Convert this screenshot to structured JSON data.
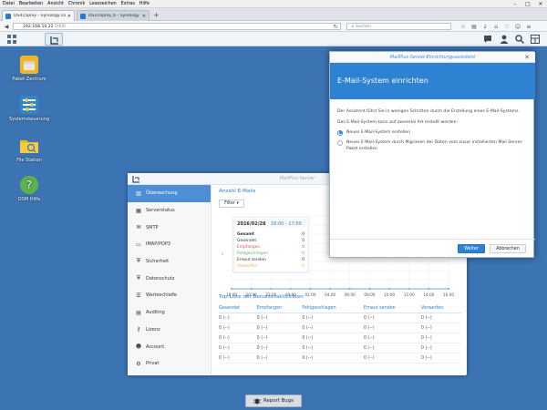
{
  "browser": {
    "menu": [
      "Datei",
      "Bearbeiten",
      "Ansicht",
      "Chronik",
      "Lesezeichen",
      "Extras",
      "Hilfe"
    ],
    "tabs": [
      {
        "label": "DS415play - Synology Disk..."
      },
      {
        "label": "DS216play_6 - Synology Dis..."
      }
    ],
    "new_tab": "+",
    "url_host": "192.168.10.22",
    "url_port": ":5000",
    "search_placeholder": "Suchen"
  },
  "desktop": {
    "icons": [
      {
        "label": "Paket-Zentrum"
      },
      {
        "label": "Systemsteuerung"
      },
      {
        "label": "File Station"
      },
      {
        "label": "DSM Hilfe"
      }
    ]
  },
  "mailplus": {
    "window_title": "MailPlus Server",
    "sidebar": [
      {
        "label": "Überwachung",
        "icon": "chart-icon"
      },
      {
        "label": "Serverstatus",
        "icon": "server-icon"
      },
      {
        "label": "SMTP",
        "icon": "envelope-icon"
      },
      {
        "label": "IMAP/POP3",
        "icon": "inbox-icon"
      },
      {
        "label": "Sicherheit",
        "icon": "shield-icon"
      },
      {
        "label": "Datenschutz",
        "icon": "lock-shield-icon"
      },
      {
        "label": "Warteschleife",
        "icon": "queue-icon"
      },
      {
        "label": "Auditing",
        "icon": "audit-icon"
      },
      {
        "label": "Lizenz",
        "icon": "key-icon"
      },
      {
        "label": "Account",
        "icon": "user-icon"
      },
      {
        "label": "Privat",
        "icon": "gear-icon"
      }
    ],
    "section_title": "Anzahl E-Mails",
    "filter_label": "Filter ▾",
    "tooltip": {
      "date": "2016/02/28",
      "time": "16:00 - 17:00",
      "rows": [
        {
          "label": "Gesamt",
          "value": "0",
          "color": "#333333"
        },
        {
          "label": "Gesendet",
          "value": "0",
          "color": "#333333"
        },
        {
          "label": "Empfangen",
          "value": "0",
          "color": "#d9534f"
        },
        {
          "label": "Fehlgeschlagen",
          "value": "0",
          "color": "#5cb85c"
        },
        {
          "label": "Erneut senden",
          "value": "0",
          "color": "#333333"
        },
        {
          "label": "Verwerfen",
          "value": "0",
          "color": "#f0ad4e"
        }
      ]
    },
    "chart_data": {
      "type": "line",
      "categories": [
        "18:00",
        "20:00",
        "22:00",
        "00:00",
        "02:00",
        "04:00",
        "06:00",
        "08:00",
        "10:00",
        "12:00",
        "14:00",
        "16:00"
      ],
      "series": [
        {
          "name": "Gesamt",
          "values": [
            0,
            0,
            0,
            0,
            0,
            0,
            0,
            0,
            0,
            0,
            0,
            0
          ]
        }
      ],
      "title": "Anzahl E-Mails",
      "ylim": [
        0,
        1
      ],
      "grid": true
    },
    "top_title": "Top-Liste der Benutzeraktivitäten",
    "table": {
      "headers": [
        "Gesendet",
        "Empfangen",
        "Fehlgeschlagen",
        "Erneut senden",
        "Verwerfen"
      ],
      "rows": [
        [
          "0 (--)",
          "0 (--)",
          "0 (--)",
          "0 (--)",
          "0 (--)"
        ],
        [
          "0 (--)",
          "0 (--)",
          "0 (--)",
          "0 (--)",
          "0 (--)"
        ],
        [
          "0 (--)",
          "0 (--)",
          "0 (--)",
          "0 (--)",
          "0 (--)"
        ],
        [
          "0 (--)",
          "0 (--)",
          "0 (--)",
          "0 (--)",
          "0 (--)"
        ],
        [
          "0 (--)",
          "0 (--)",
          "0 (--)",
          "0 (--)",
          "0 (--)"
        ]
      ]
    }
  },
  "wizard": {
    "title": "MailPlus Server-Einrichtungsassistent",
    "heading": "E-Mail-System einrichten",
    "intro": "Der Assistent führt Sie in wenigen Schritten durch die Erstellung eines E-Mail-Systems.",
    "question": "Das E-Mail-System kann auf zweierlei Art erstellt werden:",
    "option1": "Neues E-Mail-System erstellen",
    "option2": "Neues E-Mail-System durch Migrieren der Daten vom zuvor installierten Mail Server-Paket erstellen",
    "next": "Weiter",
    "cancel": "Abbrechen"
  },
  "report_bugs": "Report Bugs",
  "colors": {
    "accent": "#2d82d2",
    "desktop": "#3c74b3"
  }
}
